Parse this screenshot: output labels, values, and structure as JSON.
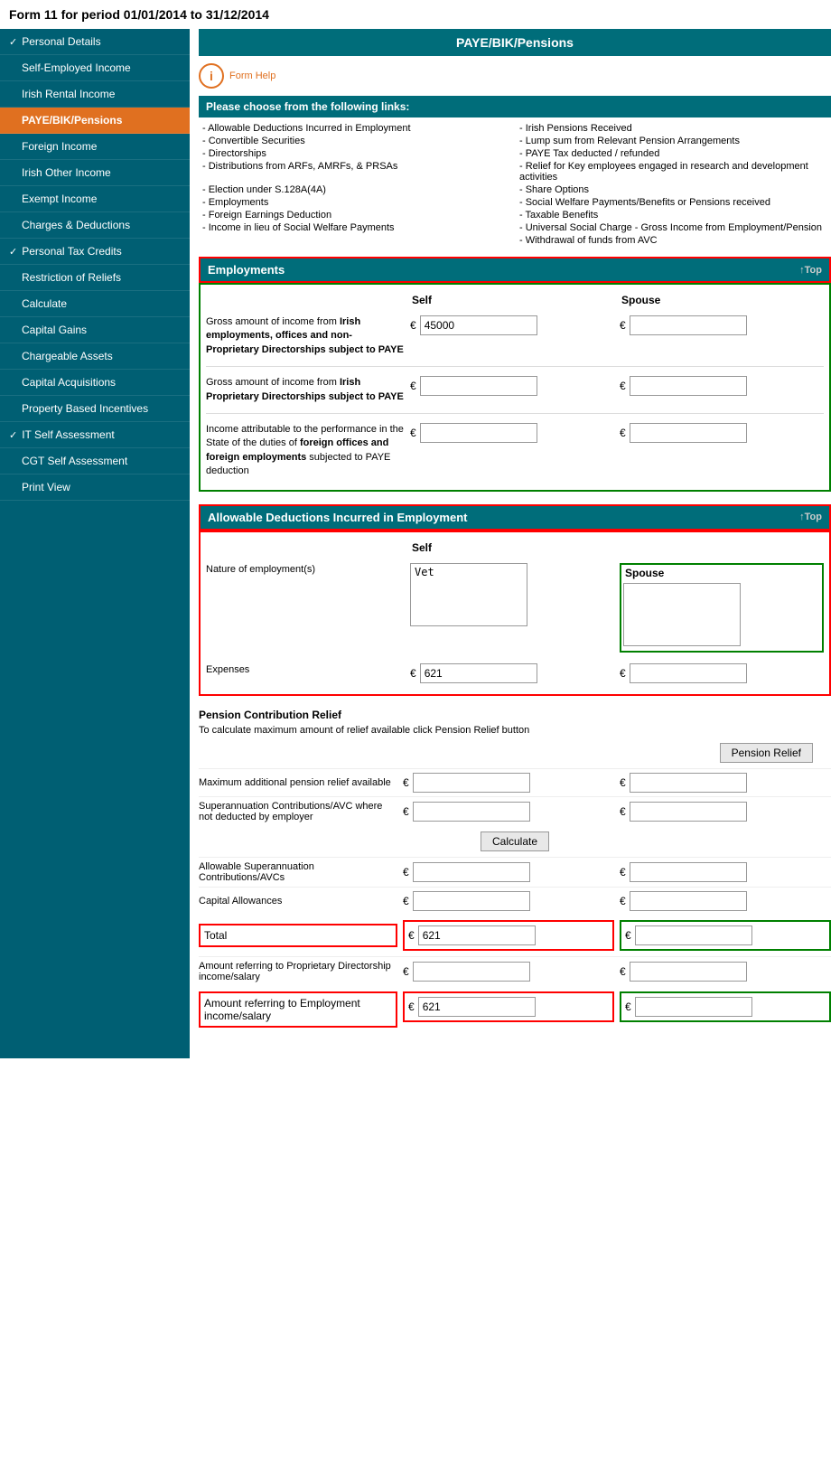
{
  "page": {
    "title": "Form 11 for period 01/01/2014 to 31/12/2014"
  },
  "sidebar": {
    "items": [
      {
        "id": "personal-details",
        "label": "Personal Details",
        "check": "✓",
        "active": false
      },
      {
        "id": "self-employed-income",
        "label": "Self-Employed Income",
        "check": "",
        "active": false
      },
      {
        "id": "irish-rental-income",
        "label": "Irish Rental Income",
        "check": "",
        "active": false
      },
      {
        "id": "paye-bik-pensions",
        "label": "PAYE/BIK/Pensions",
        "check": "",
        "active": true
      },
      {
        "id": "foreign-income",
        "label": "Foreign Income",
        "check": "",
        "active": false
      },
      {
        "id": "irish-other-income",
        "label": "Irish Other Income",
        "check": "",
        "active": false
      },
      {
        "id": "exempt-income",
        "label": "Exempt Income",
        "check": "",
        "active": false
      },
      {
        "id": "charges-deductions",
        "label": "Charges & Deductions",
        "check": "",
        "active": false
      },
      {
        "id": "personal-tax-credits",
        "label": "Personal Tax Credits",
        "check": "✓",
        "active": false
      },
      {
        "id": "restriction-of-reliefs",
        "label": "Restriction of Reliefs",
        "check": "",
        "active": false
      },
      {
        "id": "calculate",
        "label": "Calculate",
        "check": "",
        "active": false
      },
      {
        "id": "capital-gains",
        "label": "Capital Gains",
        "check": "",
        "active": false
      },
      {
        "id": "chargeable-assets",
        "label": "Chargeable Assets",
        "check": "",
        "active": false
      },
      {
        "id": "capital-acquisitions",
        "label": "Capital Acquisitions",
        "check": "",
        "active": false
      },
      {
        "id": "property-based-incentives",
        "label": "Property Based Incentives",
        "check": "",
        "active": false
      },
      {
        "id": "it-self-assessment",
        "label": "IT Self Assessment",
        "check": "✓",
        "active": false
      },
      {
        "id": "cgt-self-assessment",
        "label": "CGT Self Assessment",
        "check": "",
        "active": false
      },
      {
        "id": "print-view",
        "label": "Print View",
        "check": "",
        "active": false
      }
    ]
  },
  "content": {
    "section_title": "PAYE/BIK/Pensions",
    "form_help_label": "Form Help",
    "links_header": "Please choose from the following links:",
    "links": [
      {
        "col": 0,
        "text": "- Allowable Deductions Incurred in Employment"
      },
      {
        "col": 1,
        "text": "- Irish Pensions Received"
      },
      {
        "col": 0,
        "text": "- Convertible Securities"
      },
      {
        "col": 1,
        "text": "- Lump sum from Relevant Pension Arrangements"
      },
      {
        "col": 0,
        "text": "- Directorships"
      },
      {
        "col": 1,
        "text": "- PAYE Tax deducted / refunded"
      },
      {
        "col": 0,
        "text": "- Distributions from ARFs, AMRFs, & PRSAs"
      },
      {
        "col": 1,
        "text": "- Relief for Key employees engaged in research and development activities"
      },
      {
        "col": 0,
        "text": "- Election under S.128A(4A)"
      },
      {
        "col": 1,
        "text": "- Share Options"
      },
      {
        "col": 0,
        "text": "- Employments"
      },
      {
        "col": 1,
        "text": "- Social Welfare Payments/Benefits or Pensions received"
      },
      {
        "col": 0,
        "text": "- Foreign Earnings Deduction"
      },
      {
        "col": 1,
        "text": "- Taxable Benefits"
      },
      {
        "col": 0,
        "text": "- Income in lieu of Social Welfare Payments"
      },
      {
        "col": 1,
        "text": "- Universal Social Charge - Gross Income from Employment/Pension"
      },
      {
        "col": 1,
        "text": "- Withdrawal of funds from AVC"
      }
    ],
    "employments": {
      "title": "Employments",
      "top_link": "↑Top",
      "col_self": "Self",
      "col_spouse": "Spouse",
      "rows": [
        {
          "label": "Gross amount of income from Irish employments, offices and non-Proprietary Directorships subject to PAYE",
          "self_value": "45000",
          "spouse_value": ""
        },
        {
          "label": "Gross amount of income from Irish Proprietary Directorships subject to PAYE",
          "self_value": "",
          "spouse_value": ""
        },
        {
          "label": "Income attributable to the performance in the State of the duties of foreign offices and foreign employments subjected to PAYE deduction",
          "self_value": "",
          "spouse_value": ""
        }
      ]
    },
    "allowable_deductions": {
      "title": "Allowable Deductions Incurred in Employment",
      "top_link": "↑Top",
      "col_self": "Self",
      "col_spouse": "Spouse",
      "nature_label": "Nature of employment(s)",
      "nature_self_value": "Vet",
      "nature_spouse_value": "",
      "expenses_label": "Expenses",
      "expenses_self_value": "621",
      "expenses_spouse_value": ""
    },
    "pension": {
      "header": "Pension Contribution Relief",
      "desc": "To calculate maximum amount of relief available click Pension Relief button",
      "pension_relief_btn": "Pension Relief",
      "calculate_btn": "Calculate",
      "fields": [
        {
          "label": "Maximum additional pension relief available",
          "self_value": "",
          "spouse_value": ""
        },
        {
          "label": "Superannuation Contributions/AVC where not deducted by employer",
          "self_value": "",
          "spouse_value": ""
        },
        {
          "label": "Allowable Superannuation Contributions/AVCs",
          "self_value": "",
          "spouse_value": ""
        },
        {
          "label": "Capital Allowances",
          "self_value": "",
          "spouse_value": ""
        }
      ],
      "total_label": "Total",
      "total_self_value": "621",
      "total_spouse_value": "",
      "prop_dir_label": "Amount referring to Proprietary Directorship income/salary",
      "prop_dir_self_value": "",
      "prop_dir_spouse_value": "",
      "employment_income_label": "Amount referring to Employment income/salary",
      "employment_income_self_value": "621",
      "employment_income_spouse_value": ""
    }
  }
}
